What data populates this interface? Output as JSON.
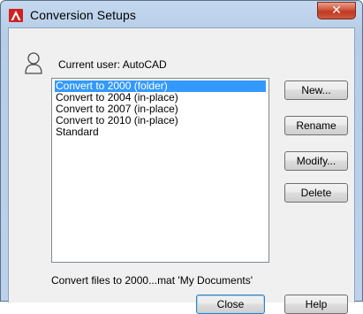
{
  "window": {
    "title": "Conversion Setups",
    "close_glyph": "✕"
  },
  "user": {
    "label": "Current user: AutoCAD",
    "icon": "user-icon"
  },
  "list": {
    "items": [
      "Convert to 2000 (folder)",
      "Convert to 2004 (in-place)",
      "Convert to 2007 (in-place)",
      "Convert to 2010 (in-place)",
      "Standard"
    ],
    "selected": "Convert to 2000 (folder)"
  },
  "buttons": {
    "new": "New...",
    "rename": "Rename",
    "modify": "Modify...",
    "delete": "Delete",
    "close": "Close",
    "help": "Help"
  },
  "description": "Convert files to 2000...mat 'My Documents'",
  "colors": {
    "selection": "#3399ff",
    "app_icon_red": "#d21f1f",
    "close_button": "#c9472c"
  }
}
